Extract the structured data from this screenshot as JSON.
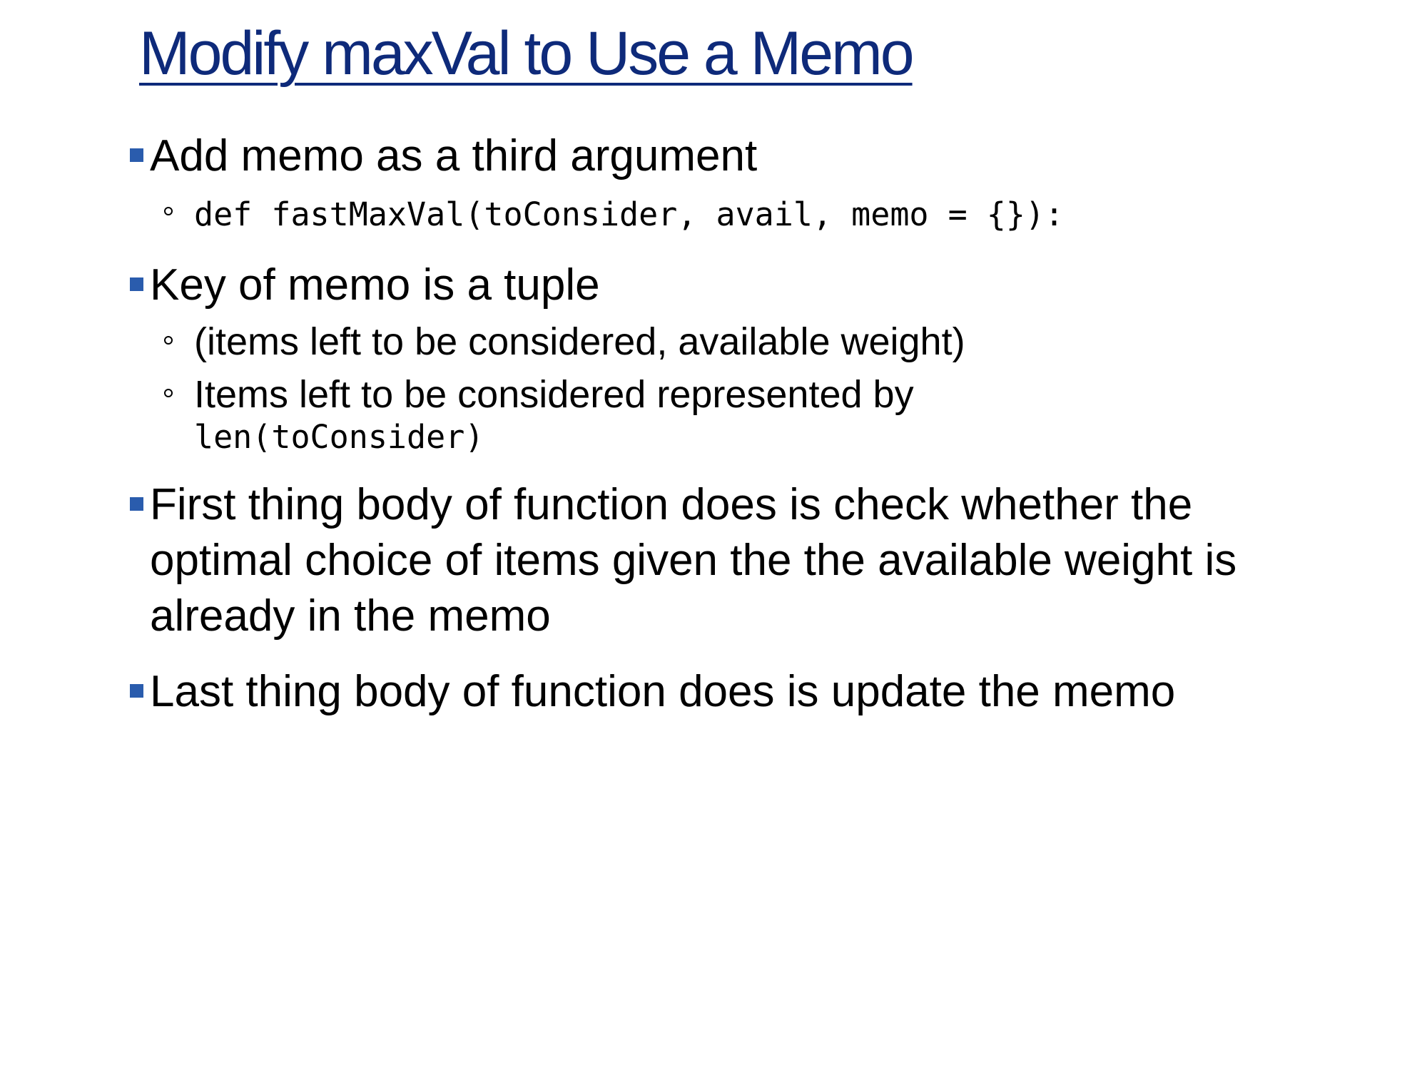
{
  "slide": {
    "title": "Modify maxVal to Use a Memo",
    "colors": {
      "title": "#0e2a7a",
      "bullet_marker": "#2a5cad",
      "text": "#000000",
      "background": "#ffffff"
    },
    "bullets": [
      {
        "text": "Add memo as a third argument",
        "sub": [
          {
            "code": "def fastMaxVal(toConsider, avail, memo = {}):"
          }
        ]
      },
      {
        "text": "Key of memo is a tuple",
        "sub": [
          {
            "text": "(items left to be considered, available weight)"
          },
          {
            "text": "Items left to be considered represented by",
            "code": "len(toConsider)"
          }
        ]
      },
      {
        "text": "First thing body of function does is check whether the optimal choice of items given the the available weight is already in the memo"
      },
      {
        "text": "Last thing body of function does is update the memo"
      }
    ]
  }
}
